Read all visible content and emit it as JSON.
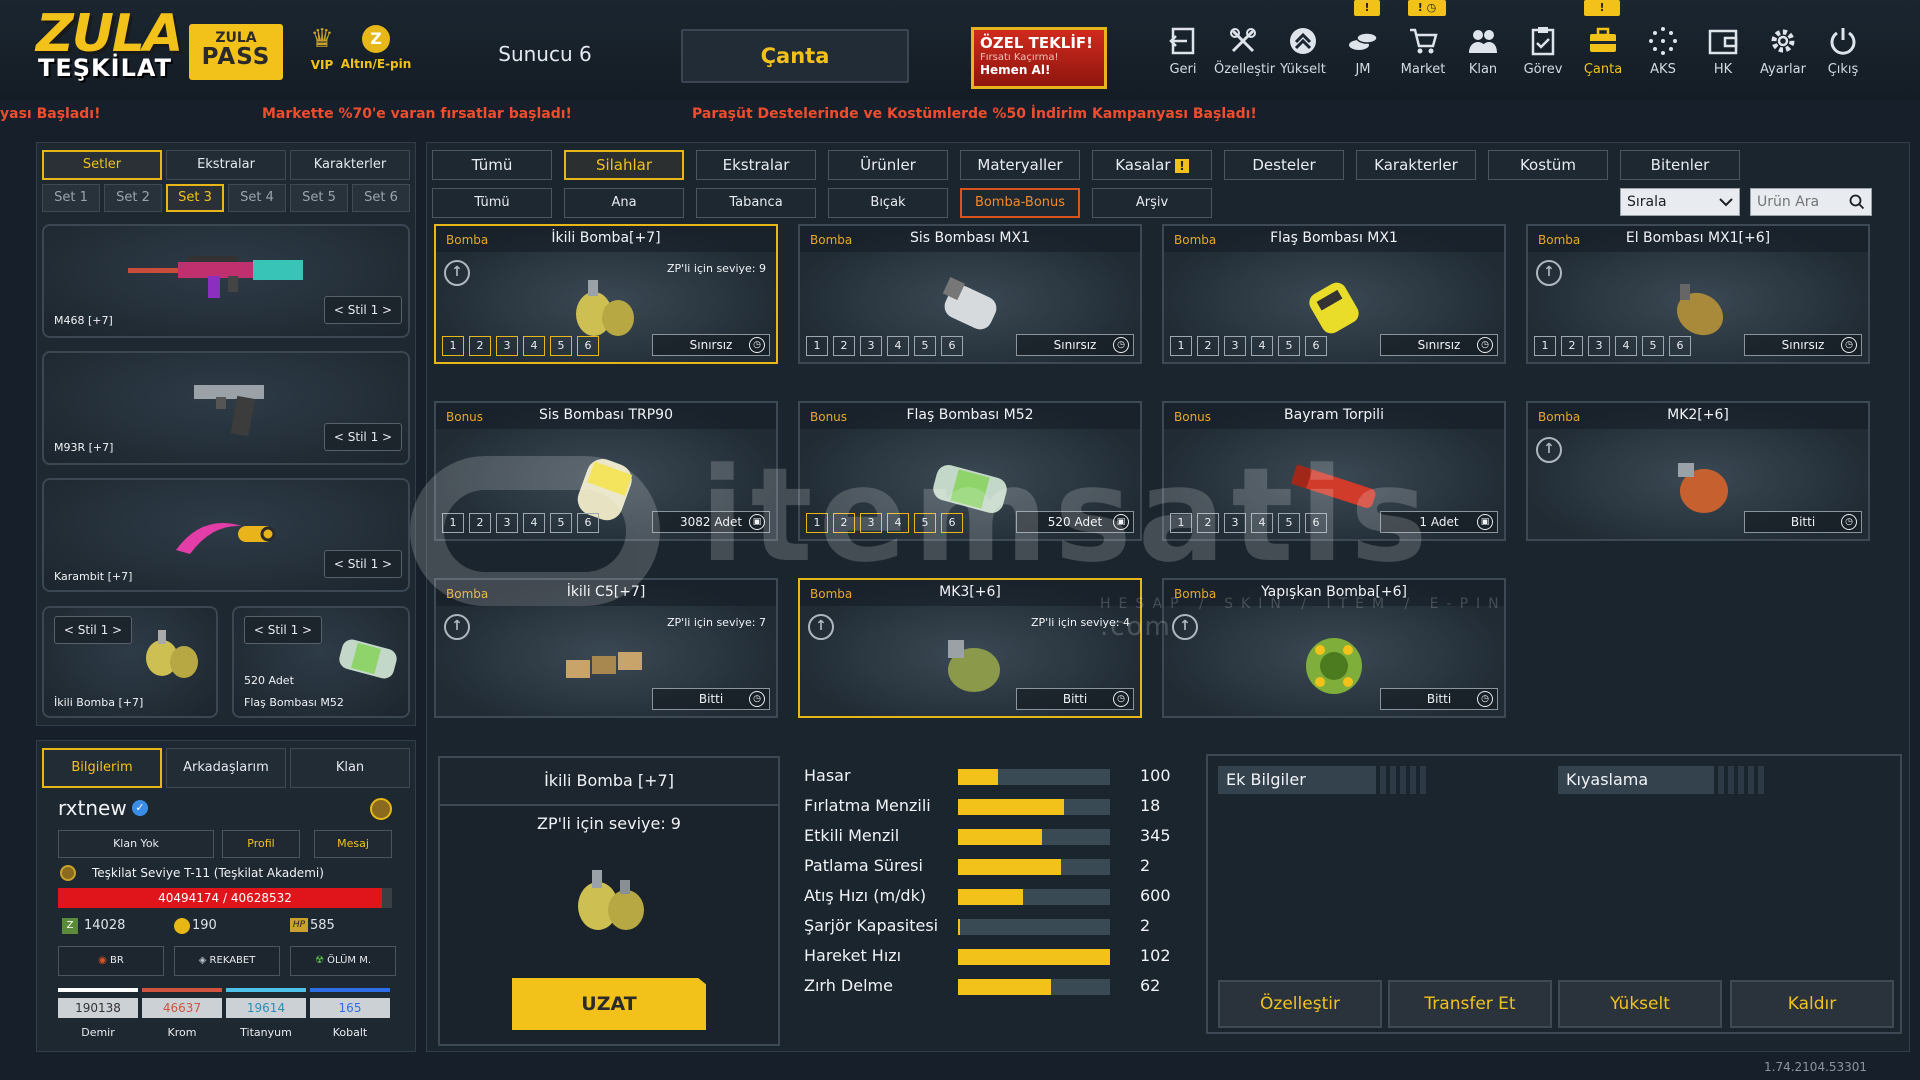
{
  "header": {
    "logo_line1": "ZULA",
    "logo_line2": "TEŞKİLAT",
    "pass_line1": "ZULA",
    "pass_line2": "PASS",
    "vip_label": "VIP",
    "ep_label": "Altın/E-pin",
    "server": "Sunucu 6",
    "canta_button": "Çanta",
    "offer_line1": "ÖZEL TEKLİF!",
    "offer_line2": "Fırsatı Kaçırma!",
    "offer_line3": "Hemen Al!",
    "nav": [
      {
        "label": "Geri",
        "icon": "back-icon"
      },
      {
        "label": "Özelleştir",
        "icon": "tools-icon"
      },
      {
        "label": "Yükselt",
        "icon": "upgrade-icon"
      },
      {
        "label": "JM",
        "icon": "coins-icon"
      },
      {
        "label": "Market",
        "icon": "cart-icon"
      },
      {
        "label": "Klan",
        "icon": "clan-icon"
      },
      {
        "label": "Görev",
        "icon": "clipboard-icon"
      },
      {
        "label": "Çanta",
        "icon": "bag-icon"
      },
      {
        "label": "AKS",
        "icon": "aks-icon"
      },
      {
        "label": "HK",
        "icon": "wallet-icon"
      },
      {
        "label": "Ayarlar",
        "icon": "gear-icon"
      },
      {
        "label": "Çıkış",
        "icon": "power-icon"
      }
    ],
    "flags": [
      "!",
      "!",
      "!"
    ]
  },
  "ticker": [
    "yası Başladı!",
    "Markette %70'e varan fırsatlar başladı!",
    "Paraşüt Destelerinde ve Kostümlerde %50 İndirim Kampanyası Başladı!"
  ],
  "left": {
    "tabs": [
      "Setler",
      "Ekstralar",
      "Karakterler"
    ],
    "sets": [
      "Set 1",
      "Set 2",
      "Set 3",
      "Set 4",
      "Set 5",
      "Set 6"
    ],
    "weapons": [
      {
        "name": "M468 [+7]",
        "style": "Stil 1"
      },
      {
        "name": "M93R [+7]",
        "style": "Stil 1"
      },
      {
        "name": "Karambit [+7]",
        "style": "Stil 1"
      }
    ],
    "mini": [
      {
        "name": "İkili Bomba [+7]",
        "style": "Stil 1",
        "count": ""
      },
      {
        "name": "Flaş Bombası M52",
        "style": "Stil 1",
        "count": "520 Adet"
      }
    ]
  },
  "profile": {
    "tabs": [
      "Bilgilerim",
      "Arkadaşlarım",
      "Klan"
    ],
    "username": "rxtnew",
    "clan_btn": "Klan Yok",
    "profile_btn": "Profil",
    "message_btn": "Mesaj",
    "level": "Teşkilat Seviye T-11 (Teşkilat Akademi)",
    "xp": "40494174 / 40628532",
    "xp_progress": 0.97,
    "zp": "14028",
    "gold": "190",
    "hp": "585",
    "modes": [
      "BR",
      "REKABET",
      "ÖLÜM M."
    ],
    "resources": [
      {
        "name": "Demir",
        "value": "190138",
        "color": "#ffffff"
      },
      {
        "name": "Krom",
        "value": "46637",
        "color": "#d0543f"
      },
      {
        "name": "Titanyum",
        "value": "19614",
        "color": "#4ec1e8"
      },
      {
        "name": "Kobalt",
        "value": "165",
        "color": "#2f6fe6"
      }
    ]
  },
  "main": {
    "categories": [
      "Tümü",
      "Silahlar",
      "Ekstralar",
      "Ürünler",
      "Materyaller",
      "Kasalar",
      "Desteler",
      "Karakterler",
      "Kostüm",
      "Bitenler"
    ],
    "kasalar_badge": "!",
    "subcategories": [
      "Tümü",
      "Ana",
      "Tabanca",
      "Bıçak",
      "Bomba-Bonus",
      "Arşiv"
    ],
    "sort_label": "Sırala",
    "search_placeholder": "Ürün Ara",
    "items": [
      {
        "kind": "Bomba",
        "name": "İkili Bomba[+7]",
        "zp": "ZP'li için seviye: 9",
        "qty": "Sınırsız",
        "slots": true,
        "up": true,
        "selected": true,
        "yslots": false
      },
      {
        "kind": "Bomba",
        "name": "Sis Bombası MX1",
        "zp": "",
        "qty": "Sınırsız",
        "slots": true,
        "up": false,
        "selected": false,
        "yslots": false
      },
      {
        "kind": "Bomba",
        "name": "Flaş Bombası MX1",
        "zp": "",
        "qty": "Sınırsız",
        "slots": true,
        "up": false,
        "selected": false,
        "yslots": false
      },
      {
        "kind": "Bomba",
        "name": "El Bombası MX1[+6]",
        "zp": "",
        "qty": "Sınırsız",
        "slots": true,
        "up": true,
        "selected": false,
        "yslots": false
      },
      {
        "kind": "Bonus",
        "name": "Sis Bombası TRP90",
        "zp": "",
        "qty": "3082 Adet",
        "slots": true,
        "up": false,
        "selected": false,
        "yslots": false
      },
      {
        "kind": "Bonus",
        "name": "Flaş Bombası M52",
        "zp": "",
        "qty": "520 Adet",
        "slots": true,
        "up": false,
        "selected": false,
        "yslots": true
      },
      {
        "kind": "Bonus",
        "name": "Bayram Torpili",
        "zp": "",
        "qty": "1 Adet",
        "slots": true,
        "up": false,
        "selected": false,
        "yslots": false
      },
      {
        "kind": "Bomba",
        "name": "MK2[+6]",
        "zp": "",
        "qty": "Bitti",
        "slots": false,
        "up": true,
        "selected": false,
        "yslots": false
      },
      {
        "kind": "Bomba",
        "name": "İkili C5[+7]",
        "zp": "ZP'li için seviye: 7",
        "qty": "Bitti",
        "slots": false,
        "up": true,
        "selected": false,
        "yslots": false
      },
      {
        "kind": "Bomba",
        "name": "MK3[+6]",
        "zp": "ZP'li için seviye: 4",
        "qty": "Bitti",
        "slots": false,
        "up": true,
        "selected": true,
        "yslots": false
      },
      {
        "kind": "Bomba",
        "name": "Yapışkan Bomba[+6]",
        "zp": "",
        "qty": "Bitti",
        "slots": false,
        "up": true,
        "selected": false,
        "yslots": false
      }
    ],
    "slot_numbers": [
      "1",
      "2",
      "3",
      "4",
      "5",
      "6"
    ]
  },
  "detail": {
    "title": "İkili Bomba [+7]",
    "zp": "ZP'li için seviye: 9",
    "extend_btn": "UZAT"
  },
  "stats": [
    {
      "label": "Hasar",
      "value": "100",
      "fill": 0.26
    },
    {
      "label": "Fırlatma Menzili",
      "value": "18",
      "fill": 0.7
    },
    {
      "label": "Etkili Menzil",
      "value": "345",
      "fill": 0.55
    },
    {
      "label": "Patlama Süresi",
      "value": "2",
      "fill": 0.68
    },
    {
      "label": "Atış Hızı (m/dk)",
      "value": "600",
      "fill": 0.43
    },
    {
      "label": "Şarjör Kapasitesi",
      "value": "2",
      "fill": 0.01
    },
    {
      "label": "Hareket Hızı",
      "value": "102",
      "fill": 1.0
    },
    {
      "label": "Zırh Delme",
      "value": "62",
      "fill": 0.61
    }
  ],
  "extra": {
    "tab1": "Ek Bilgiler",
    "tab2": "Kıyaslama",
    "buttons": [
      "Özelleştir",
      "Transfer Et",
      "Yükselt",
      "Kaldır"
    ]
  },
  "version": "1.74.2104.53301",
  "watermark": {
    "brand": "itemsatis",
    "tagline": "HESAP / SKIN / ITEM / E-PIN",
    "suffix": ".com"
  },
  "colors": {
    "accent": "#f2c21a",
    "ticker": "#ef4d2d",
    "xp_bar": "#e0141b",
    "bonus_tab": "#d8531d"
  }
}
